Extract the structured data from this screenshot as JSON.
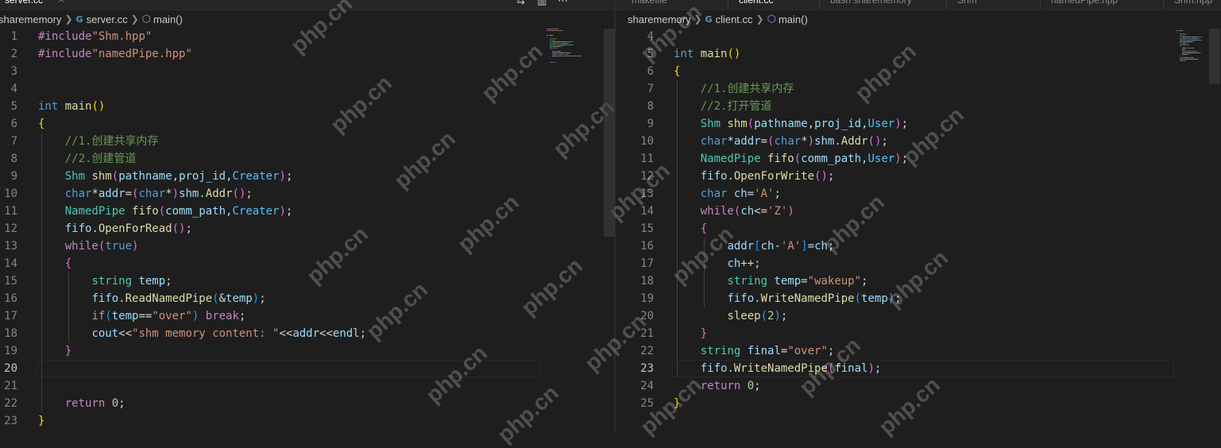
{
  "left_pane": {
    "tabs": [
      {
        "label": "server.cc",
        "active": true
      }
    ],
    "breadcrumb": {
      "folder": "sharememory",
      "file": "server.cc",
      "symbol": "main()"
    },
    "current_line": 20,
    "lines": [
      {
        "n": "1",
        "tokens": [
          [
            "pp",
            "#include"
          ],
          [
            "str",
            "\"Shm.hpp\""
          ]
        ]
      },
      {
        "n": "2",
        "tokens": [
          [
            "pp",
            "#include"
          ],
          [
            "str",
            "\"namedPipe.hpp\""
          ]
        ]
      },
      {
        "n": "3",
        "tokens": []
      },
      {
        "n": "4",
        "tokens": []
      },
      {
        "n": "5",
        "tokens": [
          [
            "type",
            "int"
          ],
          [
            "punc",
            " "
          ],
          [
            "fn",
            "main"
          ],
          [
            "b1",
            "()"
          ]
        ]
      },
      {
        "n": "6",
        "tokens": [
          [
            "b1",
            "{"
          ]
        ]
      },
      {
        "n": "7",
        "tokens": [
          [
            "punc",
            "    "
          ],
          [
            "com",
            "//1.创建共享内存"
          ]
        ]
      },
      {
        "n": "8",
        "tokens": [
          [
            "punc",
            "    "
          ],
          [
            "com",
            "//2.创建管道"
          ]
        ]
      },
      {
        "n": "9",
        "tokens": [
          [
            "punc",
            "    "
          ],
          [
            "cls",
            "Shm"
          ],
          [
            "punc",
            " "
          ],
          [
            "fn",
            "shm"
          ],
          [
            "b2",
            "("
          ],
          [
            "var",
            "pathname"
          ],
          [
            "punc",
            ","
          ],
          [
            "var",
            "proj_id"
          ],
          [
            "punc",
            ","
          ],
          [
            "blue",
            "Creater"
          ],
          [
            "b2",
            ")"
          ],
          [
            "punc",
            ";"
          ]
        ]
      },
      {
        "n": "10",
        "tokens": [
          [
            "punc",
            "    "
          ],
          [
            "type",
            "char"
          ],
          [
            "punc",
            "*"
          ],
          [
            "var",
            "addr"
          ],
          [
            "punc",
            "="
          ],
          [
            "b2",
            "("
          ],
          [
            "type",
            "char"
          ],
          [
            "punc",
            "*"
          ],
          [
            "b2",
            ")"
          ],
          [
            "var",
            "shm"
          ],
          [
            "punc",
            "."
          ],
          [
            "fn",
            "Addr"
          ],
          [
            "b2",
            "()"
          ],
          [
            "punc",
            ";"
          ]
        ]
      },
      {
        "n": "11",
        "tokens": [
          [
            "punc",
            "    "
          ],
          [
            "cls",
            "NamedPipe"
          ],
          [
            "punc",
            " "
          ],
          [
            "fn",
            "fifo"
          ],
          [
            "b2",
            "("
          ],
          [
            "var",
            "comm_path"
          ],
          [
            "punc",
            ","
          ],
          [
            "blue",
            "Creater"
          ],
          [
            "b2",
            ")"
          ],
          [
            "punc",
            ";"
          ]
        ]
      },
      {
        "n": "12",
        "tokens": [
          [
            "punc",
            "    "
          ],
          [
            "var",
            "fifo"
          ],
          [
            "punc",
            "."
          ],
          [
            "fn",
            "OpenForRead"
          ],
          [
            "b2",
            "()"
          ],
          [
            "punc",
            ";"
          ]
        ]
      },
      {
        "n": "13",
        "tokens": [
          [
            "punc",
            "    "
          ],
          [
            "ctrl",
            "while"
          ],
          [
            "b2",
            "("
          ],
          [
            "type",
            "true"
          ],
          [
            "b2",
            ")"
          ]
        ]
      },
      {
        "n": "14",
        "tokens": [
          [
            "punc",
            "    "
          ],
          [
            "b2",
            "{"
          ]
        ]
      },
      {
        "n": "15",
        "tokens": [
          [
            "punc",
            "        "
          ],
          [
            "cls",
            "string"
          ],
          [
            "punc",
            " "
          ],
          [
            "var",
            "temp"
          ],
          [
            "punc",
            ";"
          ]
        ]
      },
      {
        "n": "16",
        "tokens": [
          [
            "punc",
            "        "
          ],
          [
            "var",
            "fifo"
          ],
          [
            "punc",
            "."
          ],
          [
            "fn",
            "ReadNamedPipe"
          ],
          [
            "b3",
            "("
          ],
          [
            "punc",
            "&"
          ],
          [
            "var",
            "temp"
          ],
          [
            "b3",
            ")"
          ],
          [
            "punc",
            ";"
          ]
        ]
      },
      {
        "n": "17",
        "tokens": [
          [
            "punc",
            "        "
          ],
          [
            "ctrl",
            "if"
          ],
          [
            "b3",
            "("
          ],
          [
            "var",
            "temp"
          ],
          [
            "punc",
            "=="
          ],
          [
            "str",
            "\"over\""
          ],
          [
            "b3",
            ")"
          ],
          [
            "punc",
            " "
          ],
          [
            "ctrl",
            "break"
          ],
          [
            "punc",
            ";"
          ]
        ]
      },
      {
        "n": "18",
        "tokens": [
          [
            "punc",
            "        "
          ],
          [
            "var",
            "cout"
          ],
          [
            "punc",
            "<<"
          ],
          [
            "str",
            "\"shm memory content: \""
          ],
          [
            "punc",
            "<<"
          ],
          [
            "var",
            "addr"
          ],
          [
            "punc",
            "<<"
          ],
          [
            "var",
            "endl"
          ],
          [
            "punc",
            ";"
          ]
        ]
      },
      {
        "n": "19",
        "tokens": [
          [
            "punc",
            "    "
          ],
          [
            "b2",
            "}"
          ]
        ]
      },
      {
        "n": "20",
        "tokens": []
      },
      {
        "n": "21",
        "tokens": []
      },
      {
        "n": "22",
        "tokens": [
          [
            "punc",
            "    "
          ],
          [
            "ctrl",
            "return"
          ],
          [
            "punc",
            " "
          ],
          [
            "num",
            "0"
          ],
          [
            "punc",
            ";"
          ]
        ]
      },
      {
        "n": "23",
        "tokens": [
          [
            "b1",
            "}"
          ]
        ]
      }
    ]
  },
  "right_pane": {
    "tabs": [
      {
        "label": "makefile",
        "active": false
      },
      {
        "label": "client.cc",
        "active": true
      },
      {
        "label": "bash sharememory",
        "active": false
      },
      {
        "label": "Shm",
        "active": false
      },
      {
        "label": "namedPipe.hpp",
        "active": false
      },
      {
        "label": "Shm.hpp",
        "active": false
      }
    ],
    "breadcrumb": {
      "folder": "sharememory",
      "file": "client.cc",
      "symbol": "main()"
    },
    "current_line": 23,
    "lines": [
      {
        "n": "4",
        "tokens": []
      },
      {
        "n": "5",
        "tokens": [
          [
            "type",
            "int"
          ],
          [
            "punc",
            " "
          ],
          [
            "fn",
            "main"
          ],
          [
            "b1",
            "()"
          ]
        ]
      },
      {
        "n": "6",
        "tokens": [
          [
            "b1",
            "{"
          ]
        ]
      },
      {
        "n": "7",
        "tokens": [
          [
            "punc",
            "    "
          ],
          [
            "com",
            "//1.创建共享内存"
          ]
        ]
      },
      {
        "n": "8",
        "tokens": [
          [
            "punc",
            "    "
          ],
          [
            "com",
            "//2.打开管道"
          ]
        ]
      },
      {
        "n": "9",
        "tokens": [
          [
            "punc",
            "    "
          ],
          [
            "cls",
            "Shm"
          ],
          [
            "punc",
            " "
          ],
          [
            "fn",
            "shm"
          ],
          [
            "b2",
            "("
          ],
          [
            "var",
            "pathname"
          ],
          [
            "punc",
            ","
          ],
          [
            "var",
            "proj_id"
          ],
          [
            "punc",
            ","
          ],
          [
            "blue",
            "User"
          ],
          [
            "b2",
            ")"
          ],
          [
            "punc",
            ";"
          ]
        ]
      },
      {
        "n": "10",
        "tokens": [
          [
            "punc",
            "    "
          ],
          [
            "type",
            "char"
          ],
          [
            "punc",
            "*"
          ],
          [
            "var",
            "addr"
          ],
          [
            "punc",
            "="
          ],
          [
            "b2",
            "("
          ],
          [
            "type",
            "char"
          ],
          [
            "punc",
            "*"
          ],
          [
            "b2",
            ")"
          ],
          [
            "var",
            "shm"
          ],
          [
            "punc",
            "."
          ],
          [
            "fn",
            "Addr"
          ],
          [
            "b2",
            "()"
          ],
          [
            "punc",
            ";"
          ]
        ]
      },
      {
        "n": "11",
        "tokens": [
          [
            "punc",
            "    "
          ],
          [
            "cls",
            "NamedPipe"
          ],
          [
            "punc",
            " "
          ],
          [
            "fn",
            "fifo"
          ],
          [
            "b2",
            "("
          ],
          [
            "var",
            "comm_path"
          ],
          [
            "punc",
            ","
          ],
          [
            "blue",
            "User"
          ],
          [
            "b2",
            ")"
          ],
          [
            "punc",
            ";"
          ]
        ]
      },
      {
        "n": "12",
        "tokens": [
          [
            "punc",
            "    "
          ],
          [
            "var",
            "fifo"
          ],
          [
            "punc",
            "."
          ],
          [
            "fn",
            "OpenForWrite"
          ],
          [
            "b2",
            "()"
          ],
          [
            "punc",
            ";"
          ]
        ]
      },
      {
        "n": "13",
        "tokens": [
          [
            "punc",
            "    "
          ],
          [
            "type",
            "char"
          ],
          [
            "punc",
            " "
          ],
          [
            "var",
            "ch"
          ],
          [
            "punc",
            "="
          ],
          [
            "str",
            "'A'"
          ],
          [
            "punc",
            ";"
          ]
        ]
      },
      {
        "n": "14",
        "tokens": [
          [
            "punc",
            "    "
          ],
          [
            "ctrl",
            "while"
          ],
          [
            "b2",
            "("
          ],
          [
            "var",
            "ch"
          ],
          [
            "punc",
            "<="
          ],
          [
            "str",
            "'Z'"
          ],
          [
            "b2",
            ")"
          ]
        ]
      },
      {
        "n": "15",
        "tokens": [
          [
            "punc",
            "    "
          ],
          [
            "b2",
            "{"
          ]
        ]
      },
      {
        "n": "16",
        "tokens": [
          [
            "punc",
            "        "
          ],
          [
            "var",
            "addr"
          ],
          [
            "b3",
            "["
          ],
          [
            "var",
            "ch"
          ],
          [
            "punc",
            "-"
          ],
          [
            "str",
            "'A'"
          ],
          [
            "b3",
            "]"
          ],
          [
            "punc",
            "="
          ],
          [
            "var",
            "ch"
          ],
          [
            "punc",
            ";"
          ]
        ]
      },
      {
        "n": "17",
        "tokens": [
          [
            "punc",
            "        "
          ],
          [
            "var",
            "ch"
          ],
          [
            "punc",
            "++;"
          ]
        ]
      },
      {
        "n": "18",
        "tokens": [
          [
            "punc",
            "        "
          ],
          [
            "cls",
            "string"
          ],
          [
            "punc",
            " "
          ],
          [
            "var",
            "temp"
          ],
          [
            "punc",
            "="
          ],
          [
            "str",
            "\"wakeup\""
          ],
          [
            "punc",
            ";"
          ]
        ]
      },
      {
        "n": "19",
        "tokens": [
          [
            "punc",
            "        "
          ],
          [
            "var",
            "fifo"
          ],
          [
            "punc",
            "."
          ],
          [
            "fn",
            "WriteNamedPipe"
          ],
          [
            "b3",
            "("
          ],
          [
            "var",
            "temp"
          ],
          [
            "b3",
            ")"
          ],
          [
            "punc",
            ";"
          ]
        ]
      },
      {
        "n": "20",
        "tokens": [
          [
            "punc",
            "        "
          ],
          [
            "fn",
            "sleep"
          ],
          [
            "b3",
            "("
          ],
          [
            "num",
            "2"
          ],
          [
            "b3",
            ")"
          ],
          [
            "punc",
            ";"
          ]
        ]
      },
      {
        "n": "21",
        "tokens": [
          [
            "punc",
            "    "
          ],
          [
            "b2",
            "}"
          ]
        ]
      },
      {
        "n": "22",
        "tokens": [
          [
            "punc",
            "    "
          ],
          [
            "cls",
            "string"
          ],
          [
            "punc",
            " "
          ],
          [
            "var",
            "final"
          ],
          [
            "punc",
            "="
          ],
          [
            "str",
            "\"over\""
          ],
          [
            "punc",
            ";"
          ]
        ]
      },
      {
        "n": "23",
        "tokens": [
          [
            "punc",
            "    "
          ],
          [
            "var",
            "fifo"
          ],
          [
            "punc",
            "."
          ],
          [
            "fn",
            "WriteNamedPipe"
          ],
          [
            "b2",
            "("
          ],
          [
            "var",
            "final"
          ],
          [
            "b2",
            ")"
          ],
          [
            "punc",
            ";"
          ]
        ]
      },
      {
        "n": "24",
        "tokens": [
          [
            "punc",
            "    "
          ],
          [
            "ctrl",
            "return"
          ],
          [
            "punc",
            " "
          ],
          [
            "num",
            "0"
          ],
          [
            "punc",
            ";"
          ]
        ]
      },
      {
        "n": "25",
        "tokens": [
          [
            "b1",
            "}"
          ]
        ]
      }
    ]
  },
  "watermark_text": "php.cn",
  "colors": {
    "background": "#1e1e1e",
    "line_number": "#858585",
    "keyword": "#569cd6",
    "control": "#c586c0",
    "string": "#ce9178",
    "function": "#dcdcaa",
    "variable": "#9cdcfe",
    "type": "#4ec9b0",
    "comment": "#6a9955"
  }
}
